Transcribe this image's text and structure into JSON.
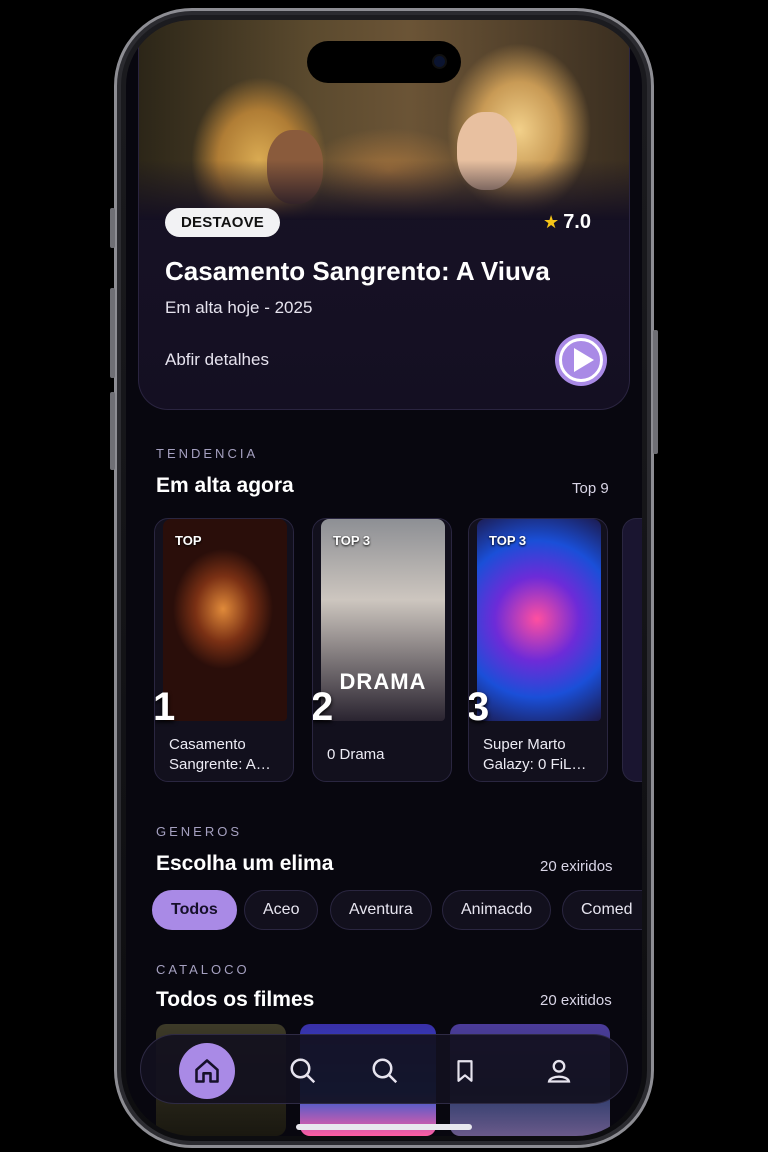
{
  "hero": {
    "badge": "DESTAOVE",
    "rating": "7.0",
    "title": "Casamento Sangrento: A Viuva",
    "subtitle": "Em alta hoje - 2025",
    "details_link": "Abfir detalhes"
  },
  "trending": {
    "eyebrow": "TENDENCIA",
    "title": "Em alta agora",
    "meta": "Top 9",
    "cards": [
      {
        "label": "TOP",
        "rank": "1",
        "title": "Casamento Sangrente: A…",
        "poster_text": ""
      },
      {
        "label": "TOP 3",
        "rank": "2",
        "title": "0 Drama",
        "poster_text": "DRAMA"
      },
      {
        "label": "TOP 3",
        "rank": "3",
        "title": "Super Marto Galazy: 0 FiL…",
        "poster_text": ""
      }
    ]
  },
  "genres": {
    "eyebrow": "GENEROS",
    "title": "Escolha um elima",
    "meta": "20 exiridos",
    "chips": [
      "Todos",
      "Aceo",
      "Aventura",
      "Animacdo",
      "Comed"
    ],
    "selected": "Todos"
  },
  "catalog": {
    "eyebrow": "CATALOCO",
    "title": "Todos os filmes",
    "meta": "20 exitidos"
  },
  "nav": {
    "items": [
      "home-icon",
      "search-icon",
      "search-icon",
      "bookmark-icon",
      "profile-icon"
    ],
    "active": "home-icon"
  },
  "colors": {
    "accent": "#a98ae6",
    "background": "#08070f",
    "star": "#f5c518"
  }
}
